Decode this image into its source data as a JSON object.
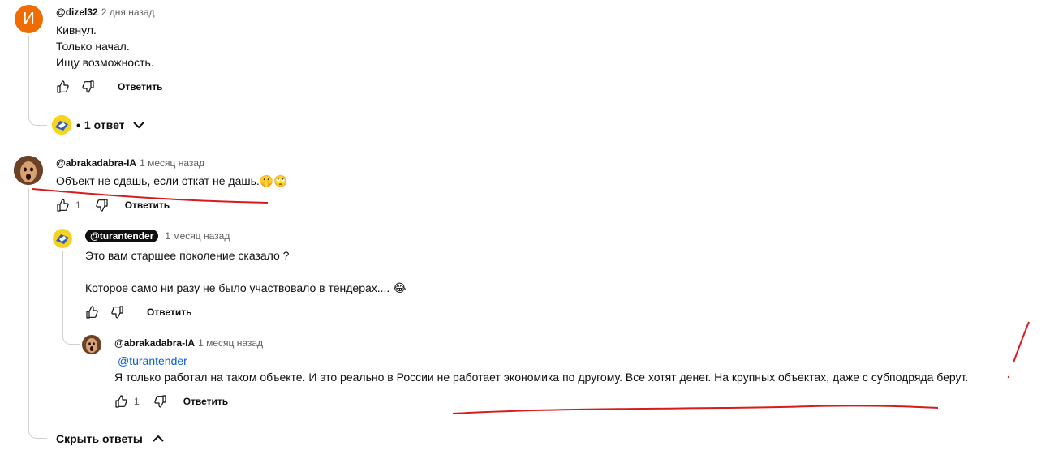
{
  "comments": [
    {
      "avatar_letter": "И",
      "author": "@dizel32",
      "time": "2 дня назад",
      "lines": [
        "Кивнул.",
        "Только начал.",
        "Ищу возможность."
      ],
      "reply_label": "Ответить"
    },
    {
      "author": "@abrakadabra-IA",
      "time": "1 месяц назад",
      "lines": [
        "Объект не сдашь, если откат не дашь.🤫🙄"
      ],
      "likes": "1",
      "reply_label": "Ответить"
    }
  ],
  "replies_summary": {
    "bullet": "•",
    "label": "1 ответ"
  },
  "replies": [
    {
      "author": "@turantender",
      "time": "1 месяц назад",
      "lines": [
        "Это вам старшее поколение сказало ?",
        "",
        "Которое само ни разу не было участвовало в тендерах.... 😂"
      ],
      "reply_label": "Ответить"
    },
    {
      "author": "@abrakadabra-IA",
      "time": "1 месяц назад",
      "mention": "@turantender",
      "lines": [
        "Я только работал на таком объекте. И это реально в России не работает экономика по другому. Все хотят денег. На крупных объектах, даже с субподряда берут."
      ],
      "likes": "1",
      "reply_label": "Ответить"
    }
  ],
  "hide_replies_label": "Скрыть ответы",
  "colors": {
    "avatar_orange": "#ef6c00",
    "annotation_red": "#d81b1b",
    "link_blue": "#065fd4"
  },
  "icons": [
    "thumb-up-icon",
    "thumb-down-icon",
    "chevron-down-icon",
    "chevron-up-icon"
  ]
}
